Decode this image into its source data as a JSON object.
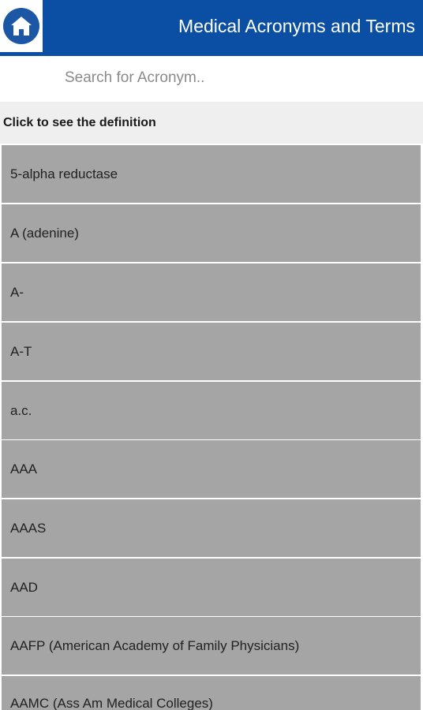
{
  "header": {
    "title": "Medical Acronyms and Terms",
    "home_icon": "home-icon",
    "color": "#0a4fa3"
  },
  "search": {
    "placeholder": "Search for Acronym..",
    "value": ""
  },
  "instruction": "Click to see the definition",
  "list": {
    "item_background": "#a5a5a5",
    "items": [
      "5-alpha reductase",
      "A (adenine)",
      "A-",
      "A-T",
      "a.c.",
      "AAA",
      "AAAS",
      "AAD",
      "AAFP (American Academy of Family Physicians)",
      "AAMC (Ass Am Medical Colleges)"
    ]
  }
}
